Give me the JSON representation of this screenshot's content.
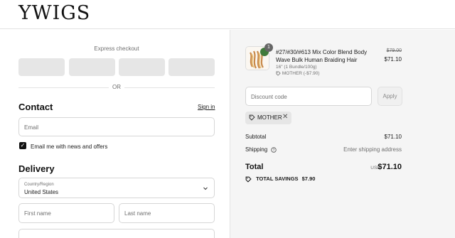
{
  "brand": {
    "logo": "YWIGS"
  },
  "checkout": {
    "express_title": "Express checkout",
    "or_text": "OR",
    "contact": {
      "heading": "Contact",
      "sign_in": "Sign in",
      "email_placeholder": "Email",
      "news_checkbox_label": "Email me with news and offers",
      "news_checked": true
    },
    "delivery": {
      "heading": "Delivery",
      "country_label": "Country/Region",
      "country_value": "United States",
      "first_name_placeholder": "First name",
      "last_name_placeholder": "Last name"
    }
  },
  "summary": {
    "item": {
      "quantity": "1",
      "title": "#27/#30/#613 Mix Color Blend Body Wave Bulk Human Braiding Hair",
      "variant": "16\" (1 Bundle/100g)",
      "discount": "MOTHER (-$7.90)",
      "price_original": "$79.00",
      "price_current": "$71.10"
    },
    "discount_placeholder": "Discount code",
    "apply_label": "Apply",
    "applied_code": "MOTHER",
    "subtotal_label": "Subtotal",
    "subtotal_value": "$71.10",
    "shipping_label": "Shipping",
    "shipping_value": "Enter shipping address",
    "total_label": "Total",
    "total_currency": "USD",
    "total_value": "$71.10",
    "savings_label": "TOTAL SAVINGS",
    "savings_value": "$7.90"
  },
  "colors": {
    "accent": "#111111",
    "panel_bg": "#f5f5f5",
    "wallet_bg": "#e6e6e6"
  }
}
